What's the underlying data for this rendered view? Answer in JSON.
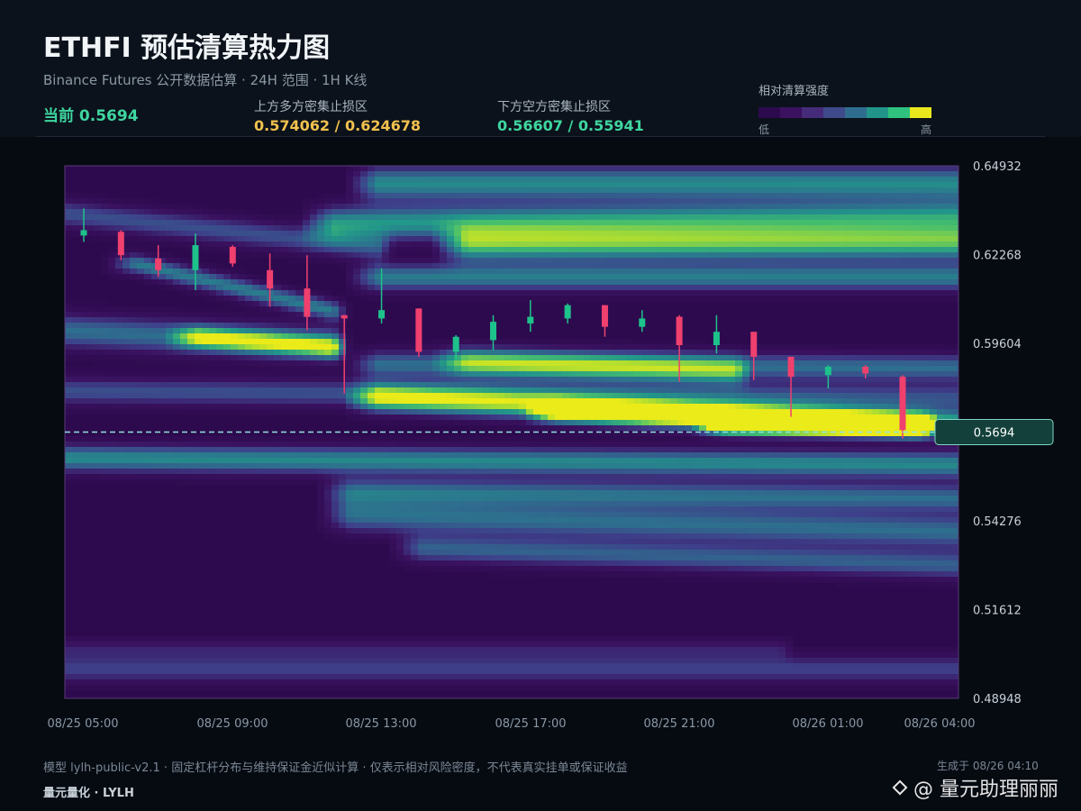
{
  "header": {
    "title": "ETHFI 预估清算热力图",
    "subtitle": "Binance Futures 公开数据估算 · 24H 范围 · 1H K线",
    "current_label": "当前",
    "current_value": "0.5694",
    "upper": {
      "label": "上方多方密集止损区",
      "value": "0.574062 / 0.624678",
      "color": "#f2c14e"
    },
    "lower": {
      "label": "下方空方密集止损区",
      "value": "0.56607 / 0.55941",
      "color": "#3fd6a0"
    },
    "legend": {
      "label": "相对清算强度",
      "low": "低",
      "high": "高",
      "colors": [
        "#2d0a4e",
        "#3b1260",
        "#452b79",
        "#3e4a8a",
        "#2f6d8e",
        "#22958a",
        "#2ec27e",
        "#e8e81d"
      ]
    }
  },
  "chart_data": {
    "type": "heatmap",
    "x_tick_labels": [
      "08/25 05:00",
      "08/25 09:00",
      "08/25 13:00",
      "08/25 17:00",
      "08/25 21:00",
      "08/26 01:00",
      "08/26 04:00"
    ],
    "y_tick_labels": [
      "0.64932",
      "0.62268",
      "0.59604",
      "0.54276",
      "0.51612",
      "0.48948"
    ],
    "ylim": [
      0.48948,
      0.64932
    ],
    "current_price": 0.5694,
    "current_price_label": "0.5694",
    "candle_colors": {
      "up": "#1ec28b",
      "down": "#f0406e"
    },
    "candles": [
      {
        "t": "08/25 05:00",
        "o": 0.6284,
        "h": 0.6365,
        "l": 0.6265,
        "c": 0.63
      },
      {
        "t": "08/25 06:00",
        "o": 0.6295,
        "h": 0.63,
        "l": 0.621,
        "c": 0.6225
      },
      {
        "t": "08/25 07:00",
        "o": 0.6215,
        "h": 0.6255,
        "l": 0.616,
        "c": 0.618
      },
      {
        "t": "08/25 08:00",
        "o": 0.618,
        "h": 0.629,
        "l": 0.612,
        "c": 0.6255
      },
      {
        "t": "08/25 09:00",
        "o": 0.625,
        "h": 0.6255,
        "l": 0.619,
        "c": 0.62
      },
      {
        "t": "08/25 10:00",
        "o": 0.618,
        "h": 0.623,
        "l": 0.607,
        "c": 0.6125
      },
      {
        "t": "08/25 11:00",
        "o": 0.6125,
        "h": 0.6225,
        "l": 0.6,
        "c": 0.604
      },
      {
        "t": "08/25 12:00",
        "o": 0.6045,
        "h": 0.6045,
        "l": 0.581,
        "c": 0.6035
      },
      {
        "t": "08/25 13:00",
        "o": 0.6035,
        "h": 0.6185,
        "l": 0.602,
        "c": 0.606
      },
      {
        "t": "08/25 14:00",
        "o": 0.6065,
        "h": 0.6065,
        "l": 0.592,
        "c": 0.5935
      },
      {
        "t": "08/25 15:00",
        "o": 0.5935,
        "h": 0.5985,
        "l": 0.591,
        "c": 0.598
      },
      {
        "t": "08/25 16:00",
        "o": 0.597,
        "h": 0.6045,
        "l": 0.594,
        "c": 0.6025
      },
      {
        "t": "08/25 17:00",
        "o": 0.602,
        "h": 0.609,
        "l": 0.5995,
        "c": 0.604
      },
      {
        "t": "08/25 18:00",
        "o": 0.6035,
        "h": 0.608,
        "l": 0.602,
        "c": 0.6075
      },
      {
        "t": "08/25 19:00",
        "o": 0.6075,
        "h": 0.6075,
        "l": 0.598,
        "c": 0.601
      },
      {
        "t": "08/25 20:00",
        "o": 0.601,
        "h": 0.606,
        "l": 0.5995,
        "c": 0.6035
      },
      {
        "t": "08/25 21:00",
        "o": 0.604,
        "h": 0.6045,
        "l": 0.5845,
        "c": 0.5955
      },
      {
        "t": "08/25 22:00",
        "o": 0.5955,
        "h": 0.6045,
        "l": 0.593,
        "c": 0.5995
      },
      {
        "t": "08/25 23:00",
        "o": 0.5995,
        "h": 0.5995,
        "l": 0.585,
        "c": 0.592
      },
      {
        "t": "08/26 00:00",
        "o": 0.592,
        "h": 0.592,
        "l": 0.574,
        "c": 0.586
      },
      {
        "t": "08/26 01:00",
        "o": 0.5865,
        "h": 0.5895,
        "l": 0.5825,
        "c": 0.589
      },
      {
        "t": "08/26 02:00",
        "o": 0.589,
        "h": 0.5895,
        "l": 0.5855,
        "c": 0.587
      },
      {
        "t": "08/26 03:00",
        "o": 0.586,
        "h": 0.5865,
        "l": 0.5675,
        "c": 0.57
      }
    ],
    "heat_bands": [
      {
        "t0": 0.0,
        "t1": 0.35,
        "p0": 0.635,
        "p1": 0.625,
        "w": 0.004,
        "i": 0.35
      },
      {
        "t0": 0.0,
        "t1": 0.3,
        "p0": 0.6,
        "p1": 0.596,
        "w": 0.005,
        "i": 0.45
      },
      {
        "t0": 0.08,
        "t1": 0.3,
        "p0": 0.62,
        "p1": 0.606,
        "w": 0.003,
        "i": 0.5
      },
      {
        "t0": 0.15,
        "t1": 0.3,
        "p0": 0.598,
        "p1": 0.595,
        "w": 0.003,
        "i": 0.65
      },
      {
        "t0": 0.0,
        "t1": 1.0,
        "p0": 0.582,
        "p1": 0.58,
        "w": 0.004,
        "i": 0.35
      },
      {
        "t0": 0.35,
        "t1": 1.0,
        "p0": 0.644,
        "p1": 0.644,
        "w": 0.005,
        "i": 0.55
      },
      {
        "t0": 0.3,
        "t1": 1.0,
        "p0": 0.632,
        "p1": 0.634,
        "w": 0.005,
        "i": 0.6
      },
      {
        "t0": 0.45,
        "t1": 1.0,
        "p0": 0.626,
        "p1": 0.6265,
        "w": 0.005,
        "i": 0.75
      },
      {
        "t0": 0.35,
        "t1": 1.0,
        "p0": 0.616,
        "p1": 0.616,
        "w": 0.004,
        "i": 0.5
      },
      {
        "t0": 0.45,
        "t1": 0.75,
        "p0": 0.591,
        "p1": 0.588,
        "w": 0.004,
        "i": 0.5
      },
      {
        "t0": 0.35,
        "t1": 1.0,
        "p0": 0.59,
        "p1": 0.589,
        "w": 0.004,
        "i": 0.45
      },
      {
        "t0": 0.35,
        "t1": 1.0,
        "p0": 0.58,
        "p1": 0.572,
        "w": 0.004,
        "i": 0.75
      },
      {
        "t0": 0.55,
        "t1": 0.96,
        "p0": 0.576,
        "p1": 0.572,
        "w": 0.003,
        "i": 0.9
      },
      {
        "t0": 0.74,
        "t1": 0.95,
        "p0": 0.5715,
        "p1": 0.5715,
        "w": 0.0025,
        "i": 1.0
      },
      {
        "t0": 0.0,
        "t1": 1.0,
        "p0": 0.562,
        "p1": 0.56,
        "w": 0.004,
        "i": 0.55
      },
      {
        "t0": 0.32,
        "t1": 1.0,
        "p0": 0.552,
        "p1": 0.55,
        "w": 0.004,
        "i": 0.45
      },
      {
        "t0": 0.32,
        "t1": 1.0,
        "p0": 0.545,
        "p1": 0.54,
        "w": 0.005,
        "i": 0.45
      },
      {
        "t0": 0.4,
        "t1": 1.0,
        "p0": 0.535,
        "p1": 0.53,
        "w": 0.004,
        "i": 0.4
      },
      {
        "t0": 0.0,
        "t1": 1.0,
        "p0": 0.499,
        "p1": 0.499,
        "w": 0.004,
        "i": 0.3
      },
      {
        "t0": 0.0,
        "t1": 0.8,
        "p0": 0.505,
        "p1": 0.505,
        "w": 0.003,
        "i": 0.18
      }
    ]
  },
  "footer": {
    "model_note": "模型 lylh-public-v2.1 · 固定杠杆分布与维持保证金近似计算 · 仅表示相对风险密度，不代表真实挂单或保证收益",
    "brand": "量元量化 · LYLH",
    "generated": "生成于 08/26 04:10",
    "watermark": "@ 量元助理丽丽"
  }
}
